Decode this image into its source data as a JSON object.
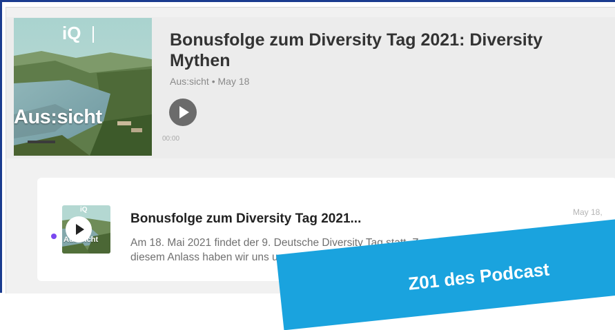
{
  "episode": {
    "title_line1": "Bonusfolge zum Diversity Tag 2021: Diversity",
    "title_line2": "Mythen",
    "podcast": "Aus:sicht",
    "date": "May 18",
    "time": "00:00"
  },
  "cover": {
    "logo": "iQ",
    "name": "Aus:sicht"
  },
  "list_item": {
    "title": "Bonusfolge zum Diversity Tag 2021...",
    "date": "May 18,",
    "desc_line1": "Am 18. Mai 2021 findet der 9. Deutsche Diversity Tag statt. Zu",
    "desc_line2": "diesem Anlass haben wir uns umgehört bei Kolleginnen un",
    "thumb_logo": "iQ",
    "thumb_name": "Aus:sicht"
  },
  "banner": {
    "text": "Z01 des Podcast"
  },
  "colors": {
    "accent_dot": "#7a48f0",
    "banner": "#1aa3de",
    "frame": "#1b3c8f"
  },
  "icons": [
    "play-icon",
    "more-icon"
  ]
}
